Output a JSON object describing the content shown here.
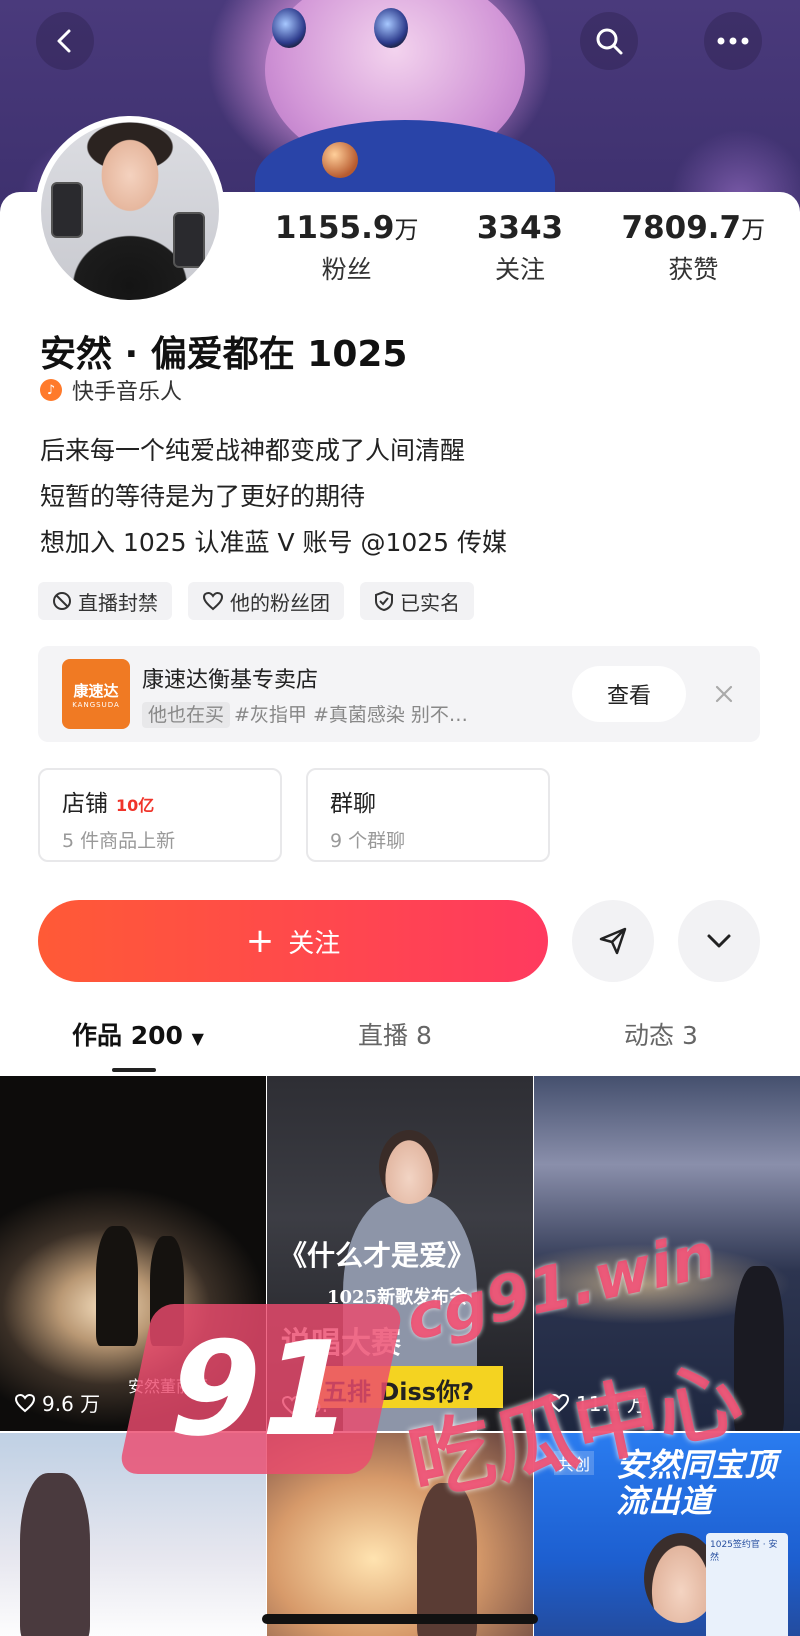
{
  "stats": [
    {
      "value": "1155.9",
      "unit": "万",
      "label": "粉丝"
    },
    {
      "value": "3343",
      "unit": "",
      "label": "关注"
    },
    {
      "value": "7809.7",
      "unit": "万",
      "label": "获赞"
    }
  ],
  "profile": {
    "name": "安然 · 偏爱都在 1025",
    "role": "快手音乐人",
    "bio": [
      "后来每一个纯爱战神都变成了人间清醒",
      "短暂的等待是为了更好的期待",
      "想加入 1025 认准蓝 V 账号 @1025 传媒"
    ]
  },
  "chips": [
    {
      "label": "直播封禁",
      "icon": "ban-icon"
    },
    {
      "label": "他的粉丝团",
      "icon": "heart-outline-icon"
    },
    {
      "label": "已实名",
      "icon": "shield-check-icon"
    }
  ],
  "promo": {
    "logo_text": "康速达",
    "logo_sub": "KANGSUDA",
    "title": "康速达衡基专卖店",
    "sub_pill": "他也在买",
    "sub_text": "#灰指甲 #真菌感染 别不…",
    "view_label": "查看"
  },
  "boxes": {
    "shop": {
      "title": "店铺",
      "badge": "10亿",
      "sub": "5 件商品上新"
    },
    "group": {
      "title": "群聊",
      "sub": "9 个群聊"
    }
  },
  "actions": {
    "follow_label": "关注",
    "follow_plus": "+"
  },
  "tabs": [
    {
      "label": "作品 200"
    },
    {
      "label": "直播 8"
    },
    {
      "label": "动态 3"
    }
  ],
  "videos": [
    {
      "likes": "9.6 万",
      "caption": "安然董丽颖"
    },
    {
      "likes": "6.",
      "title": "《什么才是爱》",
      "subtitle": "1025新歌发布会",
      "title2": "说唱大赛",
      "bar": "五排 Diss你?"
    },
    {
      "likes": "11.1 万"
    },
    {},
    {},
    {
      "text": "安然同宝顶流出道",
      "tag": "共创",
      "card": "1025签约官 · 安然"
    }
  ],
  "watermark": {
    "logo": "91",
    "domain": "cg91.win",
    "chinese": "吃瓜中心"
  },
  "colors": {
    "accent": "#ff4a4a",
    "follow_start": "#ff5a36",
    "follow_end": "#ff3a5f"
  }
}
